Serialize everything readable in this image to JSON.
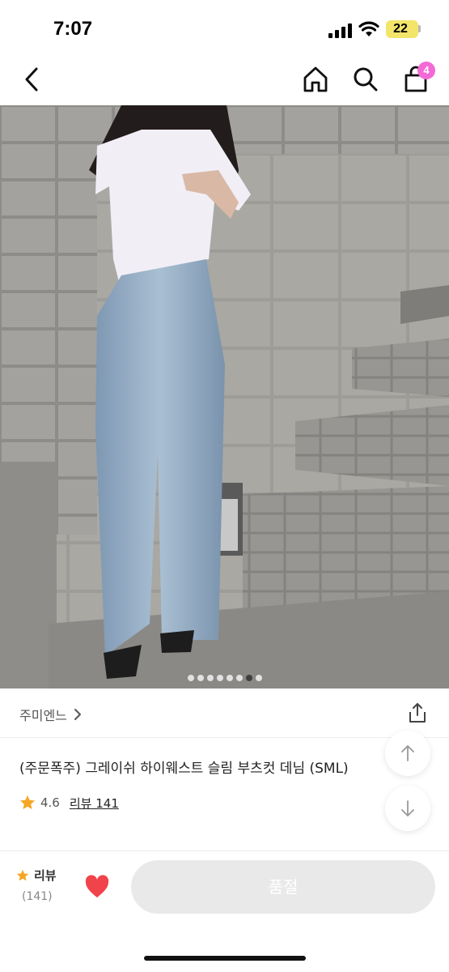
{
  "status_bar": {
    "time": "7:07",
    "battery": "22"
  },
  "nav": {
    "cart_count": "4"
  },
  "gallery": {
    "total": 8,
    "active_index": 6
  },
  "product": {
    "brand": "주미엔느",
    "title": "(주문폭주) 그레이쉬 하이웨스트 슬림 부츠컷 데님 (SML)",
    "rating": "4.6",
    "review_link": "리뷰 141"
  },
  "bottom_bar": {
    "review_label": "리뷰",
    "review_count": "(141)",
    "soldout_label": "품절"
  },
  "colors": {
    "accent_pink": "#f36ad6",
    "heart_red": "#f0434b",
    "star": "#f5a623"
  }
}
